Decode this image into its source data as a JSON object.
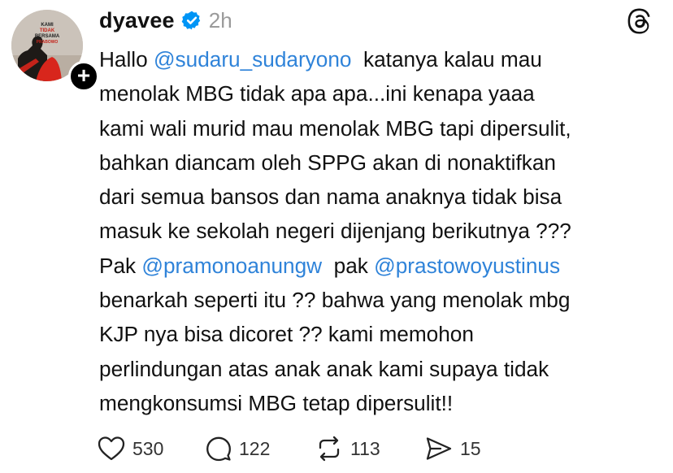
{
  "post": {
    "username": "dyavee",
    "time": "2h",
    "avatar_text": [
      "KAMI",
      "TIDAK",
      "BERSAMA",
      "PRABOWO"
    ],
    "follow_symbol": "+",
    "body": {
      "l1a": "Hallo ",
      "l1m": "@sudaru_sudaryono",
      "l1b": "  katanya kalau mau",
      "l2": "menolak MBG tidak apa apa...ini kenapa yaaa",
      "l3": "kami wali murid mau menolak MBG tapi dipersulit,",
      "l4": "bahkan diancam oleh SPPG akan di nonaktifkan",
      "l5": "dari semua bansos dan nama anaknya tidak bisa",
      "l6": "masuk ke sekolah negeri dijenjang berikutnya ???",
      "l7a": "Pak ",
      "l7m1": "@pramonoanungw",
      "l7b": "  pak ",
      "l7m2": "@prastowoyustinus",
      "l8": "benarkah seperti itu ?? bahwa yang menolak mbg",
      "l9": "KJP nya bisa dicoret ?? kami memohon",
      "l10": "perlindungan atas anak anak kami supaya tidak",
      "l11": "mengkonsumsi MBG tetap dipersulit!!"
    },
    "actions": {
      "likes": "530",
      "replies": "122",
      "reposts": "113",
      "shares": "15"
    }
  },
  "colors": {
    "mention": "#2f83d9",
    "verified": "#0095f6",
    "muted": "#9a9a9a"
  },
  "icons": [
    "plus-icon",
    "verified-badge-icon",
    "threads-logo-icon",
    "heart-icon",
    "comment-icon",
    "repost-icon",
    "share-icon"
  ]
}
